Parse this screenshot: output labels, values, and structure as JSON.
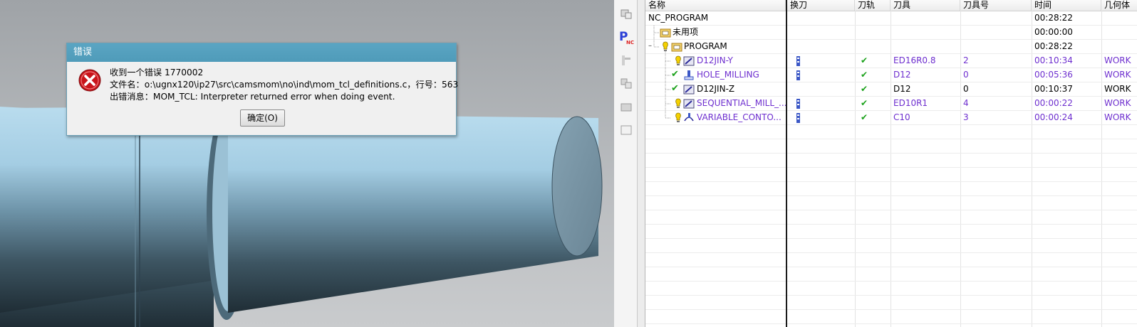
{
  "dialog": {
    "title": "错误",
    "line1": "收到一个错误 1770002",
    "line2": "文件名：o:\\ugnx120\\ip27\\src\\camsmom\\no\\ind\\mom_tcl_definitions.c，行号：563",
    "line3": "出错消息：MOM_TCL: Interpreter returned error when doing event.",
    "ok_label": "确定(O)"
  },
  "navigator": {
    "columns": [
      "名称",
      "换刀",
      "刀轨",
      "刀具",
      "刀具号",
      "时间",
      "几何体"
    ],
    "rows": [
      {
        "name": "NC_PROGRAM",
        "tool_change": "",
        "path": "",
        "tool": "",
        "tool_no": "",
        "time": "00:28:22",
        "geometry": "",
        "purple": false,
        "icon": "none"
      },
      {
        "name": "未用项",
        "tool_change": "",
        "path": "",
        "tool": "",
        "tool_no": "",
        "time": "00:00:00",
        "geometry": "",
        "purple": false,
        "icon": "program-group-icon"
      },
      {
        "name": "PROGRAM",
        "tool_change": "",
        "path": "",
        "tool": "",
        "tool_no": "",
        "time": "00:28:22",
        "geometry": "",
        "purple": false,
        "icon": "program-group-icon"
      },
      {
        "name": "D12JIN-Y",
        "tool_change": "tool-change-icon",
        "path": "✔",
        "tool": "ED16R0.8",
        "tool_no": "2",
        "time": "00:10:34",
        "geometry": "WORK",
        "purple": true,
        "icon": "mill-operation-icon"
      },
      {
        "name": "HOLE_MILLING",
        "tool_change": "tool-change-icon",
        "path": "✔",
        "tool": "D12",
        "tool_no": "0",
        "time": "00:05:36",
        "geometry": "WORK",
        "purple": true,
        "icon": "hole-milling-icon"
      },
      {
        "name": "D12JIN-Z",
        "tool_change": "",
        "path": "✔",
        "tool": "D12",
        "tool_no": "0",
        "time": "00:10:37",
        "geometry": "WORK",
        "purple": false,
        "icon": "mill-operation-icon"
      },
      {
        "name": "SEQUENTIAL_MILL_...",
        "tool_change": "tool-change-icon",
        "path": "✔",
        "tool": "ED10R1",
        "tool_no": "4",
        "time": "00:00:22",
        "geometry": "WORK",
        "purple": true,
        "icon": "mill-operation-icon"
      },
      {
        "name": "VARIABLE_CONTO...",
        "tool_change": "tool-change-icon",
        "path": "✔",
        "tool": "C10",
        "tool_no": "3",
        "time": "00:00:24",
        "geometry": "WORK",
        "purple": true,
        "icon": "variable-contour-icon"
      }
    ]
  },
  "colors": {
    "dialog_title": "#5aa5c3",
    "purple_text": "#6e2fcf",
    "check": "#1aa11a"
  }
}
